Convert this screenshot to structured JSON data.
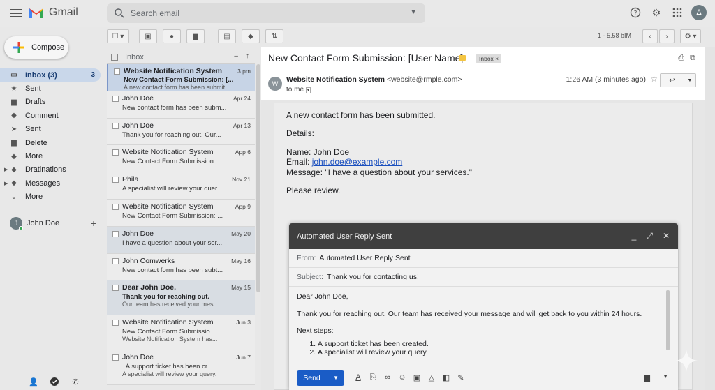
{
  "app": {
    "name": "Gmail"
  },
  "search": {
    "placeholder": "Search email"
  },
  "account_avatar": "Δ",
  "toolbar": {
    "pager": "1 - 5.58 bIM"
  },
  "compose_label": "Compose",
  "nav": [
    {
      "label": "Inbox (3)",
      "count": "3",
      "icon": "inbox-icon",
      "glyph": "▭"
    },
    {
      "label": "Sent",
      "count": "",
      "icon": "star-icon",
      "glyph": "★"
    },
    {
      "label": "Drafts",
      "count": "",
      "icon": "file-icon",
      "glyph": "▆"
    },
    {
      "label": "Comment",
      "count": "",
      "icon": "tag-icon",
      "glyph": "◆"
    },
    {
      "label": "Sent",
      "count": "",
      "icon": "send-icon",
      "glyph": "➤"
    },
    {
      "label": "Delete",
      "count": "",
      "icon": "file-icon",
      "glyph": "▆"
    },
    {
      "label": "More",
      "count": "",
      "icon": "label-icon",
      "glyph": "◆"
    },
    {
      "label": "Dratinations",
      "count": "",
      "icon": "label-icon",
      "glyph": "◆"
    },
    {
      "label": "Messages",
      "count": "",
      "icon": "label-icon",
      "glyph": "◆"
    },
    {
      "label": "More",
      "count": "",
      "icon": "chevron-down-icon",
      "glyph": "⌄"
    }
  ],
  "user": {
    "initial": "J",
    "name": "John Doe",
    "add": "+"
  },
  "list": {
    "header": "Inbox",
    "rows": [
      {
        "sender": "Website Notification System",
        "date": "3 pm",
        "subject": "New Contact Form Submission: [...",
        "snippet": "A new contact form has been submit..."
      },
      {
        "sender": "John Doe",
        "date": "Apr 24",
        "subject": "New contact form has been subm...",
        "snippet": ""
      },
      {
        "sender": "John Doe",
        "date": "Apr 13",
        "subject": "Thank you for reaching out. Our...",
        "snippet": ""
      },
      {
        "sender": "Website Notification System",
        "date": "App 6",
        "subject": "New Contact Form Submission: ...",
        "snippet": ""
      },
      {
        "sender": "Phila",
        "date": "Nov 21",
        "subject": "A specialist will review your quer...",
        "snippet": ""
      },
      {
        "sender": "Website Notification System",
        "date": "App 9",
        "subject": "New Contact Form Submission: ...",
        "snippet": ""
      },
      {
        "sender": "John Doe",
        "date": "May 20",
        "subject": "I have a question about your ser...",
        "snippet": ""
      },
      {
        "sender": "John Comwerks",
        "date": "May 16",
        "subject": "New contact form has been subt...",
        "snippet": ""
      },
      {
        "sender": "Dear John Doe,",
        "date": "May 15",
        "subject": "Thank you for reaching out.",
        "snippet": "Our team has received your mes..."
      },
      {
        "sender": "Website Notification System",
        "date": "Jun 3",
        "subject": "New Contact Form Submissio...",
        "snippet": "Website Notification System has..."
      },
      {
        "sender": "John Doe",
        "date": "Jun 7",
        "subject": ". A support ticket has been cr...",
        "snippet": "A specialist will review your query."
      }
    ]
  },
  "email": {
    "subject": "New Contact Form Submission: [User Name]",
    "label": "Inbox",
    "sender_initial": "W",
    "sender_name": "Website Notification System",
    "sender_email": "<website@rmple.com>",
    "to": "to me",
    "time": "1:26 AM (3 minutes ago)",
    "body_intro": "A new contact form has been submitted.",
    "details_label": "Details:",
    "name_line": "Name: John Doe",
    "email_label": "Email: ",
    "email_link": "john.doe@example.com",
    "message_line": "Message: \"I have a question about your services.\"",
    "closing": "Please review."
  },
  "compose": {
    "title": "Automated User Reply Sent",
    "from_label": "From:",
    "from_value": "Automated User Reply Sent",
    "subject_label": "Subject:",
    "subject_value": "Thank you for contacting us!",
    "greeting": "Dear John Doe,",
    "paragraph": "Thank you for reaching out. Our team has received your message and will get back to you within 24 hours.",
    "next_steps": "Next steps:",
    "steps": [
      "A support ticket has been created.",
      "A specialist will review your query."
    ],
    "send_label": "Send"
  }
}
